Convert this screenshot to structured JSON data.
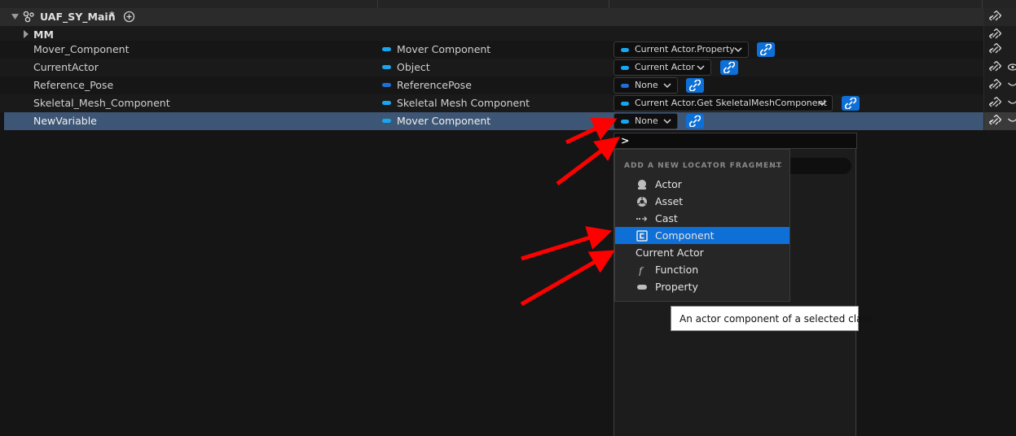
{
  "outliner": {
    "group": {
      "title": "UAF_SY_Main",
      "modified_mark": "*"
    },
    "rows": [
      {
        "label": "MM"
      },
      {
        "label": "Mover_Component",
        "type": "Mover Component",
        "value": "Current Actor.Property"
      },
      {
        "label": "CurrentActor",
        "type": "Object",
        "value": "Current Actor"
      },
      {
        "label": "Reference_Pose",
        "type": "ReferencePose",
        "value": "None"
      },
      {
        "label": "Skeletal_Mesh_Component",
        "type": "Skeletal Mesh Component",
        "value": "Current Actor.Get SkeletalMeshComponent"
      },
      {
        "label": "NewVariable",
        "type": "Mover Component",
        "value": "None"
      }
    ]
  },
  "dropdown": {
    "search_prompt": ">",
    "section_header": "ADD A NEW LOCATOR FRAGMENT",
    "items": [
      {
        "label": "Actor",
        "icon": "actor-icon"
      },
      {
        "label": "Asset",
        "icon": "asset-icon"
      },
      {
        "label": "Cast",
        "icon": "cast-icon"
      },
      {
        "label": "Component",
        "icon": "component-icon",
        "highlighted": true
      },
      {
        "label": "Current Actor",
        "icon": ""
      },
      {
        "label": "Function",
        "icon": "function-icon"
      },
      {
        "label": "Property",
        "icon": "property-icon"
      }
    ],
    "tooltip": "An actor component of a selected class"
  },
  "colors": {
    "accent": "#0e6fd6",
    "selected_row": "#3e5675",
    "type_pill": "#17a6f0",
    "annotation_arrow": "#ff0000"
  }
}
